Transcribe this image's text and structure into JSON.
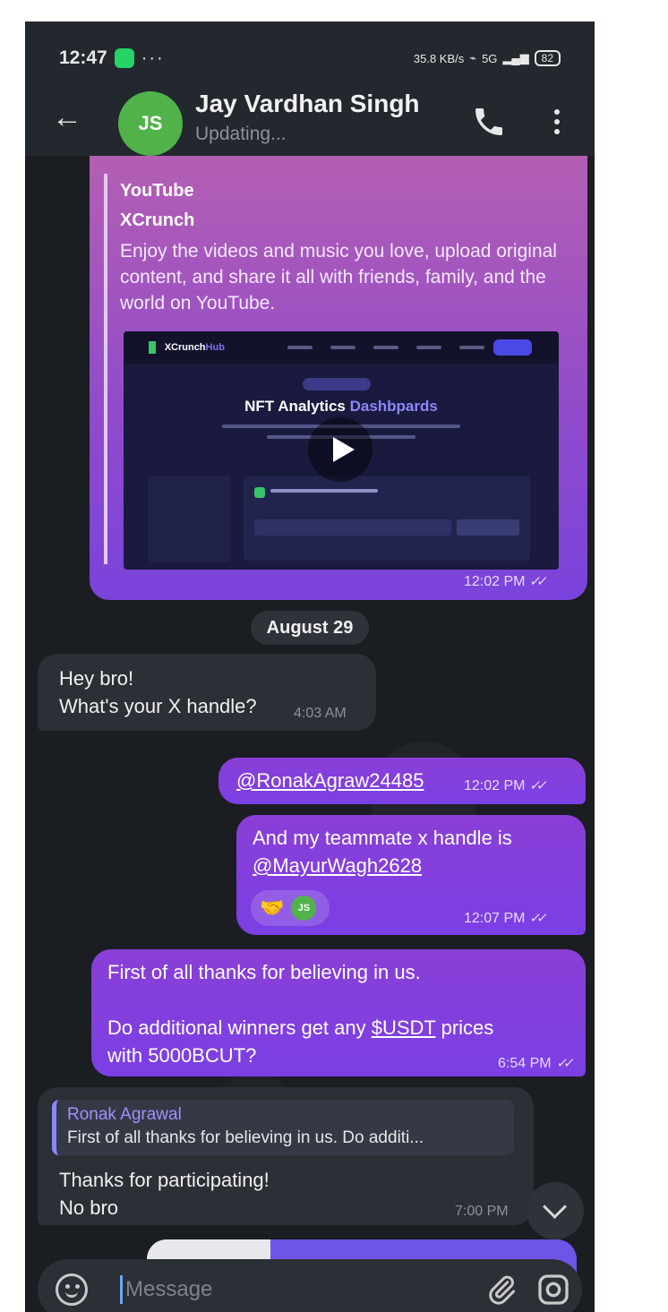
{
  "status_bar": {
    "time": "12:47",
    "dots": "···",
    "speed": "35.8 KB/s",
    "network": "5G",
    "battery": "82"
  },
  "header": {
    "avatar_initials": "JS",
    "contact_name": "Jay Vardhan Singh",
    "status": "Updating..."
  },
  "link_preview": {
    "site": "YouTube",
    "title": "XCrunch",
    "description": "Enjoy the videos and music you love, upload original content, and share it all with friends, family, and the world on YouTube.",
    "image_brand": "XCrunch",
    "image_brand_suffix": "Hub",
    "image_heading_a": "NFT Analytics ",
    "image_heading_b": "Dashbpards",
    "time": "12:02 PM"
  },
  "date_separator": "August 29",
  "messages": [
    {
      "line1": "Hey bro!",
      "line2": "What's your X handle?",
      "time": "4:03 AM"
    },
    {
      "text": "@RonakAgraw24485",
      "time": "12:02 PM"
    },
    {
      "line1": "And my teammate x handle is",
      "link": "@MayurWagh2628",
      "reaction_emoji": "🤝",
      "reaction_avatar": "JS",
      "time": "12:07 PM"
    },
    {
      "line1": "First of all thanks for believing in us.",
      "line2_prefix": "Do additional winners get any ",
      "line2_link": "$USDT",
      "line2_suffix": " prices",
      "line3": "with 5000BCUT?",
      "time": "6:54 PM"
    },
    {
      "reply_name": "Ronak Agrawal",
      "reply_text": "First of all thanks for believing in us.  Do additi...",
      "line1": "Thanks for participating!",
      "line2": "No bro",
      "time": "7:00 PM"
    }
  ],
  "composer": {
    "placeholder": "Message"
  },
  "colors": {
    "outgoing_bubble": "#7b3fe4",
    "incoming_bubble": "#2b2f36",
    "avatar": "#51b24a",
    "background": "#1a1d22"
  }
}
